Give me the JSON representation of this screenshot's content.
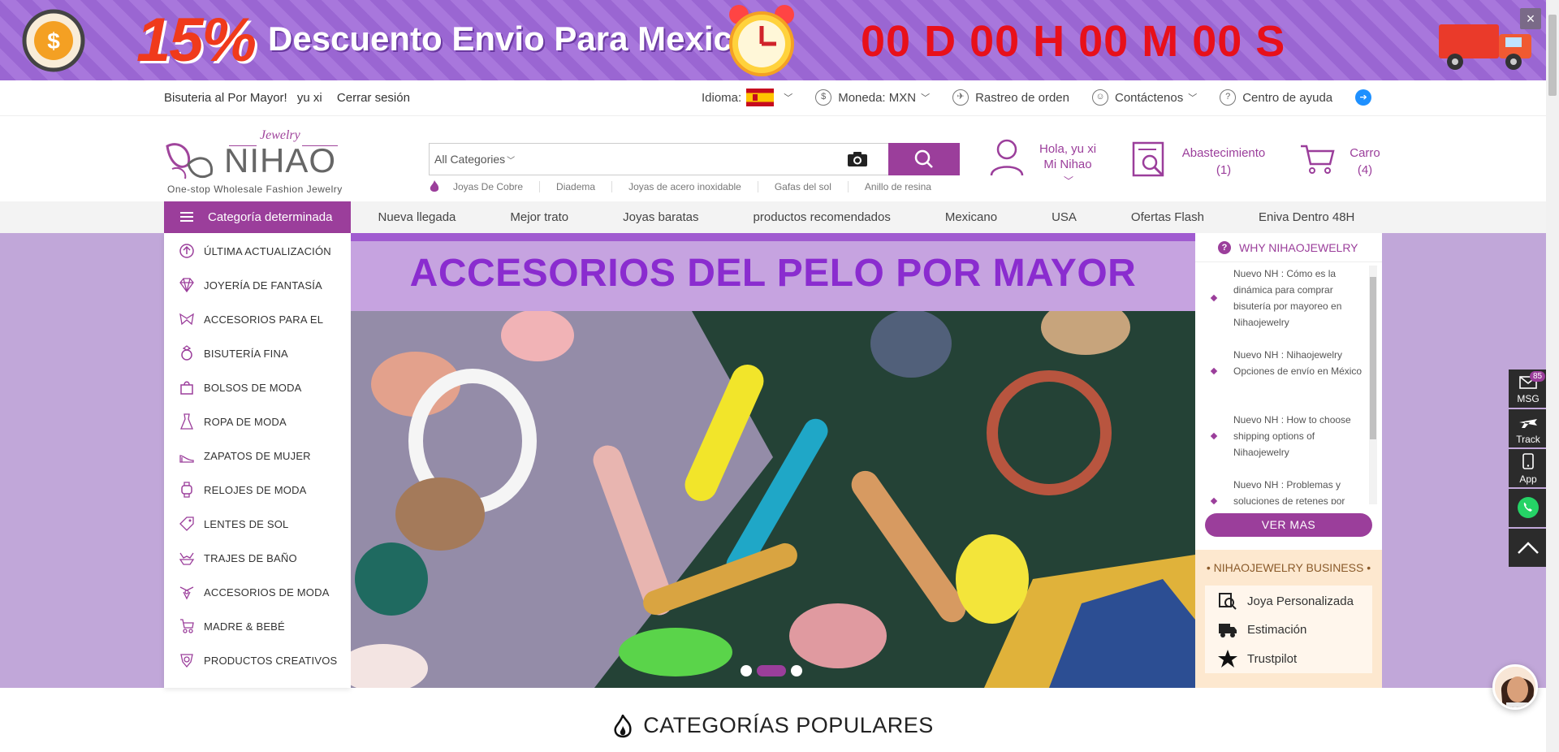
{
  "promo": {
    "discount": "15%",
    "text": "Descuento Envio Para Mexico",
    "countdown": "00 D 00 H 00 M 00 S",
    "close": "×"
  },
  "topbar": {
    "welcome": "Bisuteria al Por Mayor!",
    "user": "yu xi",
    "logout": "Cerrar sesión",
    "language_label": "Idioma:",
    "currency": "Moneda: MXN",
    "tracking": "Rastreo de orden",
    "contact": "Contáctenos",
    "help": "Centro de ayuda"
  },
  "logo": {
    "brand": "NIHAO",
    "script": "Jewelry",
    "tagline": "One-stop Wholesale Fashion Jewelry"
  },
  "search": {
    "category": "All Categories",
    "placeholder": "",
    "hot_keywords": [
      "Joyas De Cobre",
      "Diadema",
      "Joyas de acero inoxidable",
      "Gafas del sol",
      "Anillo de resina"
    ]
  },
  "account": {
    "greeting": "Hola, yu xi",
    "label": "Mi Nihao"
  },
  "sourcing": {
    "label": "Abastecimiento",
    "count": "(1)"
  },
  "cart": {
    "label": "Carro",
    "count": "(4)"
  },
  "nav": {
    "category_button": "Categoría determinada",
    "links": [
      "Nueva llegada",
      "Mejor trato",
      "Joyas baratas",
      "productos recomendados",
      "Mexicano",
      "USA",
      "Ofertas Flash",
      "Eniva Dentro 48H"
    ]
  },
  "categories": [
    {
      "label": "ÚLTIMA ACTUALIZACIÓN",
      "icon": "arrow-up-circle-icon"
    },
    {
      "label": "JOYERÍA DE FANTASÍA",
      "icon": "diamond-icon"
    },
    {
      "label": "ACCESORIOS PARA EL",
      "icon": "bow-icon"
    },
    {
      "label": "BISUTERÍA FINA",
      "icon": "ring-icon"
    },
    {
      "label": "BOLSOS DE MODA",
      "icon": "bag-icon"
    },
    {
      "label": "ROPA DE MODA",
      "icon": "dress-icon"
    },
    {
      "label": "ZAPATOS DE MUJER",
      "icon": "heel-icon"
    },
    {
      "label": "RELOJES DE MODA",
      "icon": "watch-icon"
    },
    {
      "label": "LENTES DE SOL",
      "icon": "tag-icon"
    },
    {
      "label": "TRAJES DE BAÑO",
      "icon": "swimsuit-icon"
    },
    {
      "label": "ACCESORIOS DE MODA",
      "icon": "accessory-icon"
    },
    {
      "label": "MADRE & BEBÉ",
      "icon": "stroller-icon"
    },
    {
      "label": "PRODUCTOS CREATIVOS",
      "icon": "creative-icon"
    }
  ],
  "slider": {
    "title": "ACCESORIOS DEL PELO POR MAYOR",
    "active_dot": 2
  },
  "why": {
    "title": "WHY NIHAOJEWELRY",
    "news": [
      "Nuevo NH : Cómo es la dinámica para comprar bisutería por mayoreo en Nihaojewelry",
      "Nuevo NH : Nihaojewelry Opciones de envío en México",
      "Nuevo NH : How to choose shipping options of Nihaojewelry",
      "Nuevo NH : Problemas y soluciones de retenes por"
    ],
    "more": "VER MAS"
  },
  "business": {
    "title": "• NIHAOJEWELRY BUSINESS •",
    "items": [
      "Joya Personalizada",
      "Estimación",
      "Trustpilot"
    ]
  },
  "floating": {
    "msg": "MSG",
    "msg_count": "85",
    "track": "Track",
    "app": "App"
  },
  "popular": {
    "title": "CATEGORÍAS POPULARES"
  },
  "colors": {
    "brand": "#9b3e9b",
    "promo_red": "#e8101a"
  }
}
